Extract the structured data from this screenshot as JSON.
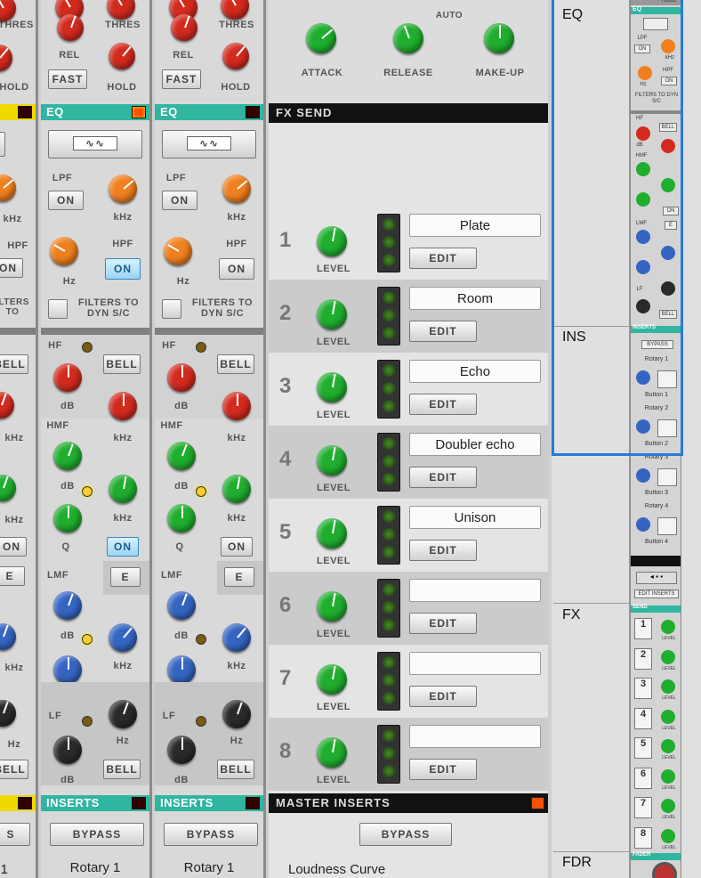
{
  "strips": [
    {
      "name": "partial",
      "dyn_labels": [
        "THRES",
        "REL",
        "HOLD"
      ],
      "fast": "FAST"
    },
    {
      "name": "strip-a",
      "dyn_labels": [
        "THRES",
        "REL",
        "HOLD"
      ],
      "fast": "FAST",
      "eq_header": "EQ",
      "lpf": "LPF",
      "hpf": "HPF",
      "on": "ON",
      "khz": "kHz",
      "hz": "Hz",
      "db": "dB",
      "filters": "FILTERS TO DYN S/C",
      "hf": "HF",
      "bell": "BELL",
      "hmf": "HMF",
      "lmf": "LMF",
      "lf": "LF",
      "q": "Q",
      "e": "E",
      "inserts": "INSERTS",
      "bypass": "BYPASS",
      "rotary": "Rotary 1"
    },
    {
      "name": "strip-b",
      "dyn_labels": [
        "THRES",
        "REL",
        "HOLD"
      ],
      "fast": "FAST",
      "eq_header": "EQ",
      "lpf": "LPF",
      "hpf": "HPF",
      "on": "ON",
      "khz": "kHz",
      "hz": "Hz",
      "db": "dB",
      "filters": "FILTERS TO DYN S/C",
      "hf": "HF",
      "bell": "BELL",
      "hmf": "HMF",
      "lmf": "LMF",
      "lf": "LF",
      "q": "Q",
      "e": "E",
      "inserts": "INSERTS",
      "bypass": "BYPASS",
      "rotary": "Rotary 1"
    }
  ],
  "partial": {
    "s": "S",
    "one": "1",
    "bell": "BELL",
    "on": "ON",
    "e": "E",
    "khz": "kHz",
    "hz": "Hz",
    "hpf": "HPF",
    "filters": "ILTERS TO",
    "dyn": "S/C",
    "hold": "HOLD"
  },
  "master": {
    "attack": "ATTACK",
    "release": "RELEASE",
    "makeup": "MAKE-UP",
    "auto": "AUTO",
    "fx_send": "FX SEND",
    "level": "LEVEL",
    "edit": "EDIT",
    "sends": [
      {
        "n": "1",
        "name": "Plate"
      },
      {
        "n": "2",
        "name": "Room"
      },
      {
        "n": "3",
        "name": "Echo"
      },
      {
        "n": "4",
        "name": "Doubler echo"
      },
      {
        "n": "5",
        "name": "Unison"
      },
      {
        "n": "6",
        "name": ""
      },
      {
        "n": "7",
        "name": ""
      },
      {
        "n": "8",
        "name": ""
      }
    ],
    "master_inserts": "MASTER INSERTS",
    "bypass": "BYPASS",
    "loudness": "Loudness Curve"
  },
  "nav": {
    "eq": "EQ",
    "ins": "INS",
    "fx": "FX",
    "fdr": "FDR"
  },
  "mini": {
    "eq": "EQ",
    "inserts": "INSERTS",
    "bypass": "BYPASS",
    "rotary1": "Rotary 1",
    "button1": "Button 1",
    "rotary2": "Rotary 2",
    "button2": "Button 2",
    "rotary3": "Rotary 3",
    "button3": "Button 3",
    "rotary4": "Rotary 4",
    "button4": "Button 4",
    "edit_inserts": "EDIT INSERTS",
    "send": "SEND",
    "fader": "FADER",
    "hold": "HOLD",
    "nums": [
      "1",
      "2",
      "3",
      "4",
      "5",
      "6",
      "7",
      "8"
    ],
    "pre": "PRE",
    "level": "LEVEL",
    "on": "ON",
    "bell": "BELL",
    "lpf": "LPF",
    "hpf": "HPF",
    "khz": "kHz",
    "hz": "Hz",
    "db": "dB",
    "hf": "HF",
    "hmf": "HMF",
    "lmf": "LMF",
    "lf": "LF",
    "filters": "FILTERS TO DYN S/C",
    "e": "E"
  },
  "colors": {
    "teal": "#2fb5a0",
    "yellow": "#f1d900",
    "select": "#2a7ad3",
    "led": "#ff5000"
  }
}
